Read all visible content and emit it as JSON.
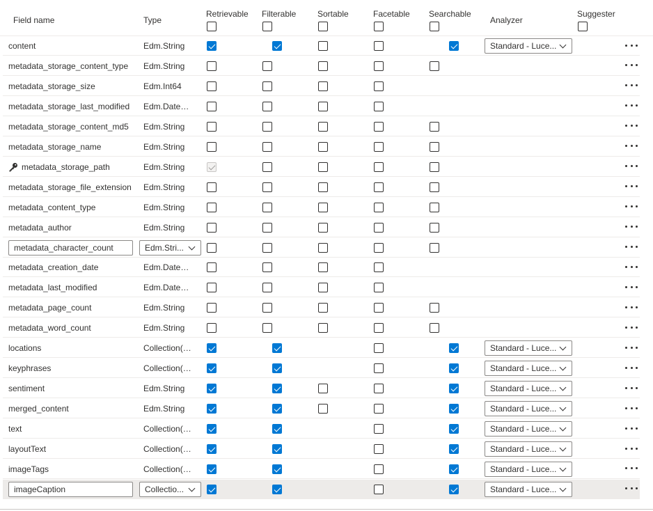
{
  "headers": {
    "field_name": "Field name",
    "type": "Type",
    "retrievable": "Retrievable",
    "filterable": "Filterable",
    "sortable": "Sortable",
    "facetable": "Facetable",
    "searchable": "Searchable",
    "analyzer": "Analyzer",
    "suggester": "Suggester"
  },
  "colors": {
    "accent": "#0078d4",
    "border": "#8a8886",
    "row_selected": "#edebe9"
  },
  "rows": [
    {
      "name": "content",
      "type": "Edm.String",
      "r": "on",
      "f": "on",
      "s": "off",
      "fa": "off",
      "se": "on",
      "analyzer": "Standard - Luce..."
    },
    {
      "name": "metadata_storage_content_type",
      "type": "Edm.String",
      "r": "off",
      "f": "off",
      "s": "off",
      "fa": "off",
      "se": "off",
      "analyzer": ""
    },
    {
      "name": "metadata_storage_size",
      "type": "Edm.Int64",
      "r": "off",
      "f": "off",
      "s": "off",
      "fa": "off",
      "se": "none",
      "analyzer": ""
    },
    {
      "name": "metadata_storage_last_modified",
      "type": "Edm.DateTi...",
      "r": "off",
      "f": "off",
      "s": "off",
      "fa": "off",
      "se": "none",
      "analyzer": ""
    },
    {
      "name": "metadata_storage_content_md5",
      "type": "Edm.String",
      "r": "off",
      "f": "off",
      "s": "off",
      "fa": "off",
      "se": "off",
      "analyzer": ""
    },
    {
      "name": "metadata_storage_name",
      "type": "Edm.String",
      "r": "off",
      "f": "off",
      "s": "off",
      "fa": "off",
      "se": "off",
      "analyzer": ""
    },
    {
      "name": "metadata_storage_path",
      "type": "Edm.String",
      "r": "dis",
      "f": "off",
      "s": "off",
      "fa": "off",
      "se": "off",
      "analyzer": "",
      "key": true
    },
    {
      "name": "metadata_storage_file_extension",
      "type": "Edm.String",
      "r": "off",
      "f": "off",
      "s": "off",
      "fa": "off",
      "se": "off",
      "analyzer": ""
    },
    {
      "name": "metadata_content_type",
      "type": "Edm.String",
      "r": "off",
      "f": "off",
      "s": "off",
      "fa": "off",
      "se": "off",
      "analyzer": ""
    },
    {
      "name": "metadata_author",
      "type": "Edm.String",
      "r": "off",
      "f": "off",
      "s": "off",
      "fa": "off",
      "se": "off",
      "analyzer": ""
    },
    {
      "name": "metadata_character_count",
      "type": "Edm.Stri...",
      "r": "off",
      "f": "off",
      "s": "off",
      "fa": "off",
      "se": "off",
      "analyzer": "",
      "editing": true
    },
    {
      "name": "metadata_creation_date",
      "type": "Edm.DateTi...",
      "r": "off",
      "f": "off",
      "s": "off",
      "fa": "off",
      "se": "none",
      "analyzer": ""
    },
    {
      "name": "metadata_last_modified",
      "type": "Edm.DateTi...",
      "r": "off",
      "f": "off",
      "s": "off",
      "fa": "off",
      "se": "none",
      "analyzer": ""
    },
    {
      "name": "metadata_page_count",
      "type": "Edm.String",
      "r": "off",
      "f": "off",
      "s": "off",
      "fa": "off",
      "se": "off",
      "analyzer": ""
    },
    {
      "name": "metadata_word_count",
      "type": "Edm.String",
      "r": "off",
      "f": "off",
      "s": "off",
      "fa": "off",
      "se": "off",
      "analyzer": ""
    },
    {
      "name": "locations",
      "type": "Collection(E...",
      "r": "on",
      "f": "on",
      "s": "none",
      "fa": "off",
      "se": "on",
      "analyzer": "Standard - Luce..."
    },
    {
      "name": "keyphrases",
      "type": "Collection(E...",
      "r": "on",
      "f": "on",
      "s": "none",
      "fa": "off",
      "se": "on",
      "analyzer": "Standard - Luce..."
    },
    {
      "name": "sentiment",
      "type": "Edm.String",
      "r": "on",
      "f": "on",
      "s": "off",
      "fa": "off",
      "se": "on",
      "analyzer": "Standard - Luce..."
    },
    {
      "name": "merged_content",
      "type": "Edm.String",
      "r": "on",
      "f": "on",
      "s": "off",
      "fa": "off",
      "se": "on",
      "analyzer": "Standard - Luce..."
    },
    {
      "name": "text",
      "type": "Collection(E...",
      "r": "on",
      "f": "on",
      "s": "none",
      "fa": "off",
      "se": "on",
      "analyzer": "Standard - Luce..."
    },
    {
      "name": "layoutText",
      "type": "Collection(E...",
      "r": "on",
      "f": "on",
      "s": "none",
      "fa": "off",
      "se": "on",
      "analyzer": "Standard - Luce..."
    },
    {
      "name": "imageTags",
      "type": "Collection(E...",
      "r": "on",
      "f": "on",
      "s": "none",
      "fa": "off",
      "se": "on",
      "analyzer": "Standard - Luce..."
    },
    {
      "name": "imageCaption",
      "type": "Collectio...",
      "r": "on",
      "f": "on",
      "s": "none",
      "fa": "off",
      "se": "on",
      "analyzer": "Standard - Luce...",
      "editing": true,
      "selected": true
    }
  ]
}
